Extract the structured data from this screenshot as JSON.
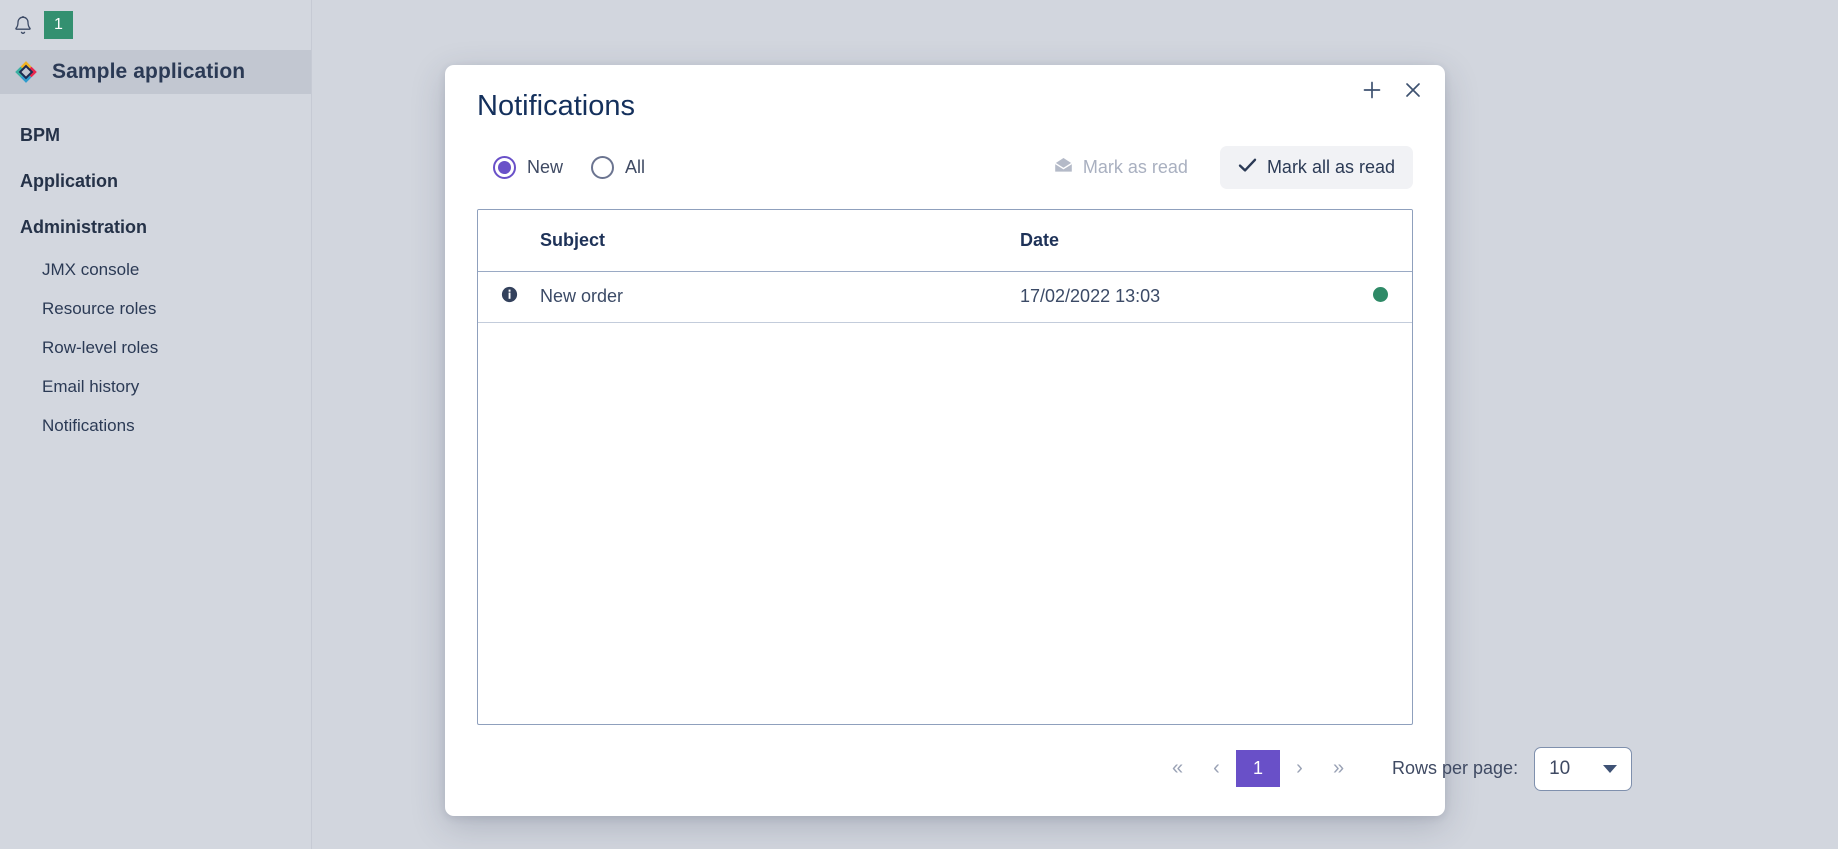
{
  "sidebar": {
    "notification": {
      "bell_icon": "bell-icon",
      "badge_count": "1",
      "badge_color": "#339070"
    },
    "app": {
      "logo_icon": "app-logo-diamond-icon",
      "title": "Sample application"
    },
    "menu": [
      {
        "type": "section",
        "label": "BPM"
      },
      {
        "type": "section",
        "label": "Application"
      },
      {
        "type": "section",
        "label": "Administration"
      },
      {
        "type": "item",
        "label": "JMX console"
      },
      {
        "type": "item",
        "label": "Resource roles"
      },
      {
        "type": "item",
        "label": "Row-level roles"
      },
      {
        "type": "item",
        "label": "Email history"
      },
      {
        "type": "item",
        "label": "Notifications"
      }
    ]
  },
  "dialog": {
    "title": "Notifications",
    "controls": {
      "expand_icon": "plus-icon",
      "close_icon": "close-icon"
    },
    "filter": {
      "options": [
        {
          "label": "New",
          "selected": true
        },
        {
          "label": "All",
          "selected": false
        }
      ],
      "accent_color": "#6950c8"
    },
    "actions": {
      "mark_as_read": {
        "label": "Mark as read",
        "icon": "envelope-open-icon",
        "disabled": true
      },
      "mark_all_as_read": {
        "label": "Mark all as read",
        "icon": "check-icon",
        "disabled": false
      }
    },
    "table": {
      "columns": [
        "",
        "Subject",
        "Date",
        ""
      ],
      "headers": {
        "subject": "Subject",
        "date": "Date"
      },
      "rows": [
        {
          "type_icon": "info-icon",
          "subject": "New order",
          "date": "17/02/2022 13:03",
          "status_icon": "unread-dot-icon",
          "status_color": "#2f8a67"
        }
      ]
    },
    "pagination": {
      "first_label": "«",
      "prev_label": "‹",
      "current_page": "1",
      "next_label": "›",
      "last_label": "»",
      "rows_per_page_label": "Rows per page:",
      "rows_per_page_value": "10",
      "active_color": "#6950c8"
    }
  }
}
